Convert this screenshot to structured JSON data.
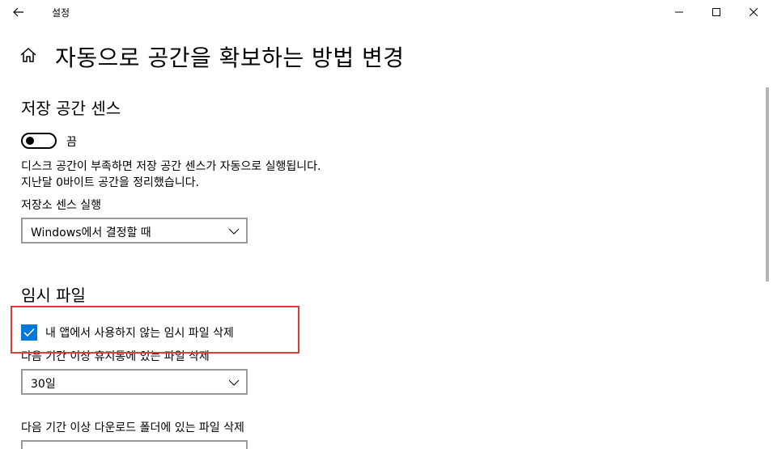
{
  "window": {
    "title": "설정",
    "back_icon": "arrow-left-icon",
    "minimize_icon": "minimize-icon",
    "maximize_icon": "maximize-icon",
    "close_icon": "close-icon"
  },
  "header": {
    "home_icon": "home-icon",
    "title": "자동으로 공간을 확보하는 방법 변경"
  },
  "storage_sense": {
    "section_title": "저장 공간 센스",
    "toggle_state_label": "끔",
    "toggle_on": false,
    "description_line1": "디스크 공간이 부족하면 저장 공간 센스가 자동으로 실행됩니다.",
    "description_line2": "지난달 0바이트 공간을 정리했습니다.",
    "run_label": "저장소 센스 실행",
    "run_value": "Windows에서 결정할 때"
  },
  "temp_files": {
    "section_title": "임시 파일",
    "delete_unused_label": "내 앱에서 사용하지 않는 임시 파일 삭제",
    "delete_unused_checked": true,
    "recycle_label": "다음 기간 이상 휴지통에 있는 파일 삭제",
    "recycle_value": "30일",
    "downloads_label": "다음 기간 이상 다운로드 폴더에 있는 파일 삭제"
  },
  "colors": {
    "accent": "#0078d7",
    "highlight": "#e03a3a"
  }
}
